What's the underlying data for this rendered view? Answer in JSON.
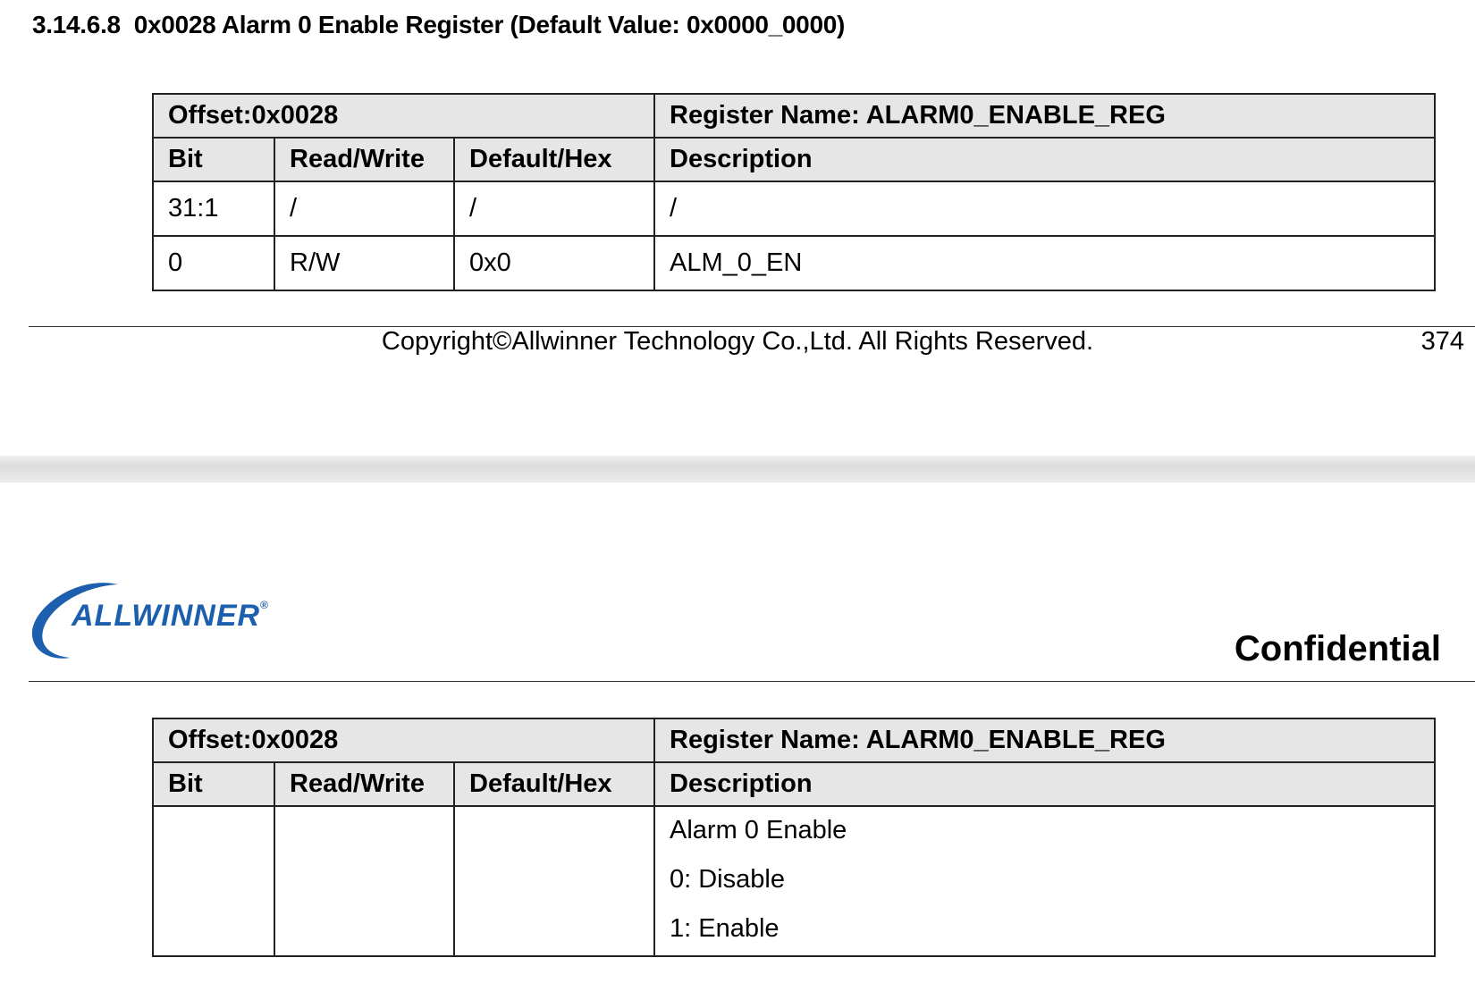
{
  "section": {
    "heading": "3.14.6.8  0x0028 Alarm 0 Enable Register (Default Value: 0x0000_0000)"
  },
  "table_1": {
    "offset": "Offset:0x0028",
    "register_name": "Register Name: ALARM0_ENABLE_REG",
    "columns": [
      "Bit",
      "Read/Write",
      "Default/Hex",
      "Description"
    ],
    "rows": [
      {
        "bit": "31:1",
        "rw": "/",
        "default": "/",
        "description": "/"
      },
      {
        "bit": "0",
        "rw": "R/W",
        "default": "0x0",
        "description": "ALM_0_EN"
      }
    ]
  },
  "footer": {
    "copyright": "Copyright©Allwinner Technology Co.,Ltd. All Rights Reserved.",
    "page_number": "374"
  },
  "header": {
    "logo": "ALLWINNER",
    "confidential": "Confidential"
  },
  "table_2": {
    "offset": "Offset:0x0028",
    "register_name": "Register Name: ALARM0_ENABLE_REG",
    "columns": [
      "Bit",
      "Read/Write",
      "Default/Hex",
      "Description"
    ],
    "rows": [
      {
        "bit": "",
        "rw": "",
        "default": "",
        "description_lines": [
          "Alarm 0 Enable",
          "0: Disable",
          "1: Enable"
        ]
      }
    ]
  }
}
